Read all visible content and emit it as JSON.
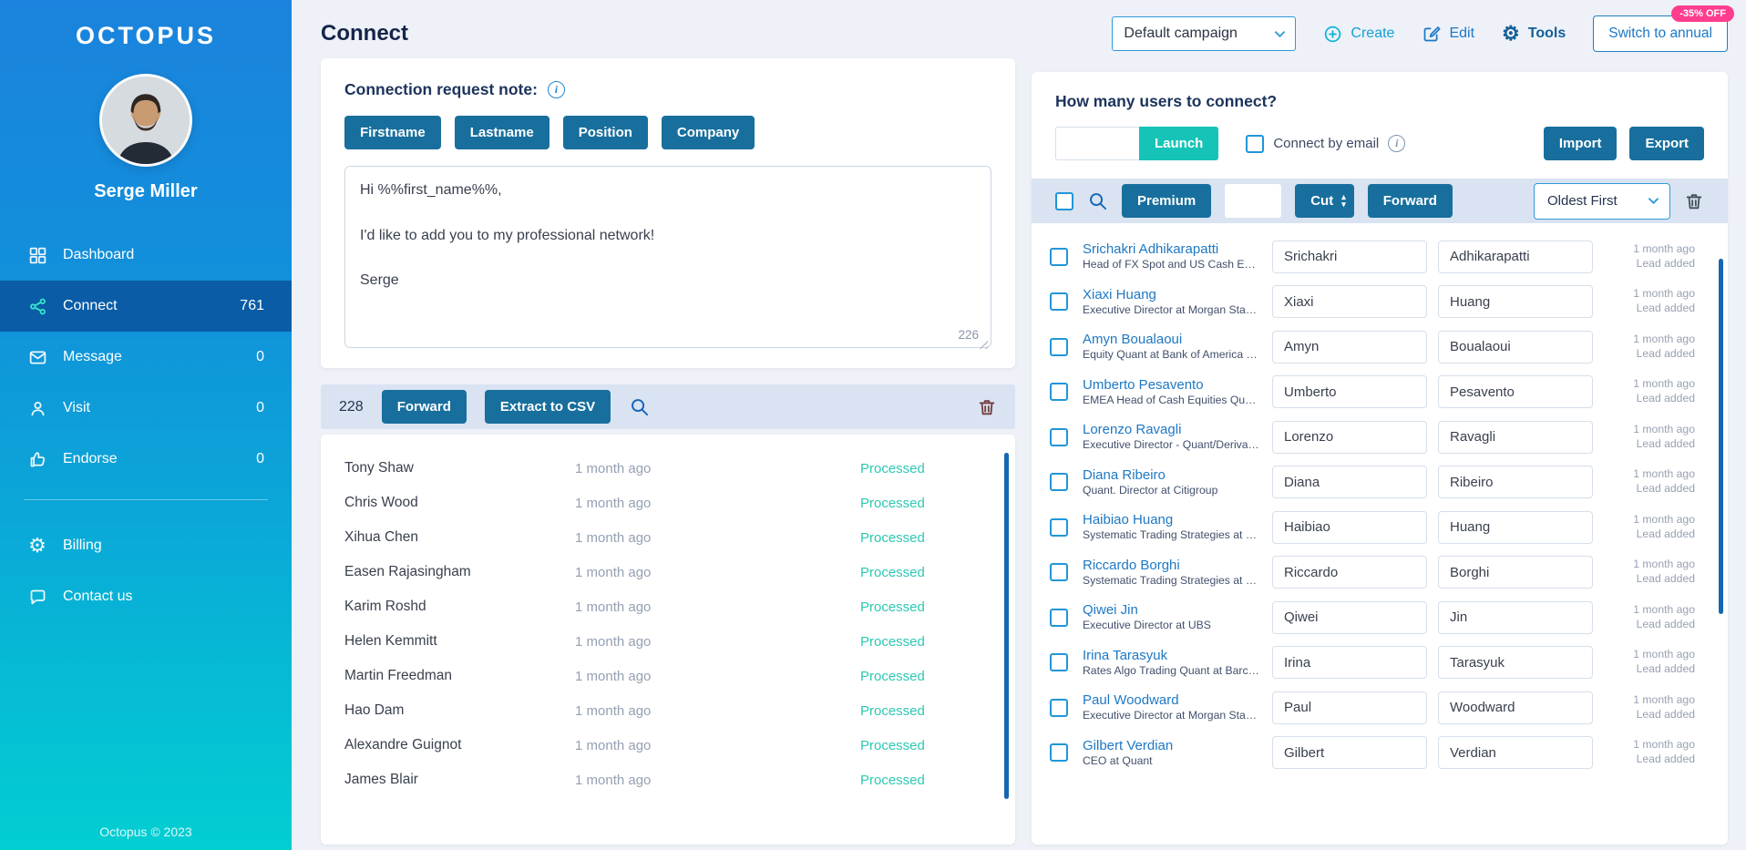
{
  "colors": {
    "sidebar_top": "#1b83dd",
    "sidebar_bottom": "#02ced2",
    "active_menu": "#0a5ca6",
    "primary_button": "#186f9d",
    "launch_button": "#16c3b7",
    "processed_status": "#2dc8b2",
    "discount_badge_bg": "#ff3d8f",
    "link_blue": "#1e78c4",
    "scrollbar_blue": "#1467b0",
    "toolbar_strip": "#d9e3f1"
  },
  "icons": {
    "create-icon": "circle-plus",
    "edit-icon": "pencil-square",
    "tools-icon": "gear",
    "billing-icon": "gear",
    "info-icon": "circle-i",
    "search-icon": "magnifier",
    "trash-icon": "trash-can",
    "chevron-down-icon": "chevron-down",
    "dashboard-icon": "grid",
    "connect-icon": "share-nodes",
    "message-icon": "envelope",
    "visit-icon": "person",
    "endorse-icon": "thumbs-up",
    "contact-icon": "chat-bubble",
    "cut-spinner-icon": "up-down-arrows"
  },
  "sidebar": {
    "logo_text": "OCTOPUS",
    "user_name": "Serge Miller",
    "items": [
      {
        "label": "Dashboard",
        "count": ""
      },
      {
        "label": "Connect",
        "count": "761"
      },
      {
        "label": "Message",
        "count": "0"
      },
      {
        "label": "Visit",
        "count": "0"
      },
      {
        "label": "Endorse",
        "count": "0"
      }
    ],
    "secondary_items": [
      {
        "label": "Billing"
      },
      {
        "label": "Contact us"
      }
    ],
    "footer": "Octopus © 2023"
  },
  "header": {
    "title": "Connect",
    "campaign_select_value": "Default campaign",
    "create_label": "Create",
    "edit_label": "Edit",
    "tools_label": "Tools",
    "switch_annual_label": "Switch to annual",
    "discount_badge": "-35% OFF"
  },
  "note_panel": {
    "title": "Connection request note:",
    "tags": [
      "Firstname",
      "Lastname",
      "Position",
      "Company"
    ],
    "note_text": "Hi %%first_name%%,\n\nI'd like to add you to my professional network!\n\nSerge",
    "char_count": "226"
  },
  "processed_panel": {
    "count": "228",
    "forward_label": "Forward",
    "extract_csv_label": "Extract to CSV",
    "rows": [
      {
        "name": "Tony Shaw",
        "time": "1 month ago",
        "status": "Processed"
      },
      {
        "name": "Chris Wood",
        "time": "1 month ago",
        "status": "Processed"
      },
      {
        "name": "Xihua Chen",
        "time": "1 month ago",
        "status": "Processed"
      },
      {
        "name": "Easen Rajasingham",
        "time": "1 month ago",
        "status": "Processed"
      },
      {
        "name": "Karim Roshd",
        "time": "1 month ago",
        "status": "Processed"
      },
      {
        "name": "Helen Kemmitt",
        "time": "1 month ago",
        "status": "Processed"
      },
      {
        "name": "Martin Freedman",
        "time": "1 month ago",
        "status": "Processed"
      },
      {
        "name": "Hao Dam",
        "time": "1 month ago",
        "status": "Processed"
      },
      {
        "name": "Alexandre Guignot",
        "time": "1 month ago",
        "status": "Processed"
      },
      {
        "name": "James Blair",
        "time": "1 month ago",
        "status": "Processed"
      }
    ]
  },
  "connect_panel": {
    "title": "How many users to connect?",
    "users_input_value": "",
    "launch_label": "Launch",
    "connect_by_email_label": "Connect by email",
    "import_label": "Import",
    "export_label": "Export",
    "premium_label": "Premium",
    "cut_input_value": "",
    "cut_label": "Cut",
    "forward_label": "Forward",
    "sort_value": "Oldest First",
    "rows": [
      {
        "name": "Srichakri Adhikarapatti",
        "subtitle": "Head of FX Spot and US Cash Equ…",
        "first_name": "Srichakri",
        "last_name": "Adhikarapatti",
        "time": "1 month ago",
        "status": "Lead added"
      },
      {
        "name": "Xiaxi Huang",
        "subtitle": "Executive Director at Morgan Stan…",
        "first_name": "Xiaxi",
        "last_name": "Huang",
        "time": "1 month ago",
        "status": "Lead added"
      },
      {
        "name": "Amyn Boualaoui",
        "subtitle": "Equity Quant at Bank of America …",
        "first_name": "Amyn",
        "last_name": "Boualaoui",
        "time": "1 month ago",
        "status": "Lead added"
      },
      {
        "name": "Umberto Pesavento",
        "subtitle": "EMEA Head of Cash Equities Qua…",
        "first_name": "Umberto",
        "last_name": "Pesavento",
        "time": "1 month ago",
        "status": "Lead added"
      },
      {
        "name": "Lorenzo Ravagli",
        "subtitle": "Executive Director - Quant/Deriva…",
        "first_name": "Lorenzo",
        "last_name": "Ravagli",
        "time": "1 month ago",
        "status": "Lead added"
      },
      {
        "name": "Diana Ribeiro",
        "subtitle": "Quant. Director at Citigroup",
        "first_name": "Diana",
        "last_name": "Ribeiro",
        "time": "1 month ago",
        "status": "Lead added"
      },
      {
        "name": "Haibiao Huang",
        "subtitle": "Systematic Trading Strategies at G…",
        "first_name": "Haibiao",
        "last_name": "Huang",
        "time": "1 month ago",
        "status": "Lead added"
      },
      {
        "name": "Riccardo Borghi",
        "subtitle": "Systematic Trading Strategies at G…",
        "first_name": "Riccardo",
        "last_name": "Borghi",
        "time": "1 month ago",
        "status": "Lead added"
      },
      {
        "name": "Qiwei Jin",
        "subtitle": "Executive Director at UBS",
        "first_name": "Qiwei",
        "last_name": "Jin",
        "time": "1 month ago",
        "status": "Lead added"
      },
      {
        "name": "Irina Tarasyuk",
        "subtitle": "Rates Algo Trading Quant at Barcl…",
        "first_name": "Irina",
        "last_name": "Tarasyuk",
        "time": "1 month ago",
        "status": "Lead added"
      },
      {
        "name": "Paul Woodward",
        "subtitle": "Executive Director at Morgan Stan…",
        "first_name": "Paul",
        "last_name": "Woodward",
        "time": "1 month ago",
        "status": "Lead added"
      },
      {
        "name": "Gilbert Verdian",
        "subtitle": "CEO at Quant",
        "first_name": "Gilbert",
        "last_name": "Verdian",
        "time": "1 month ago",
        "status": "Lead added"
      }
    ]
  }
}
